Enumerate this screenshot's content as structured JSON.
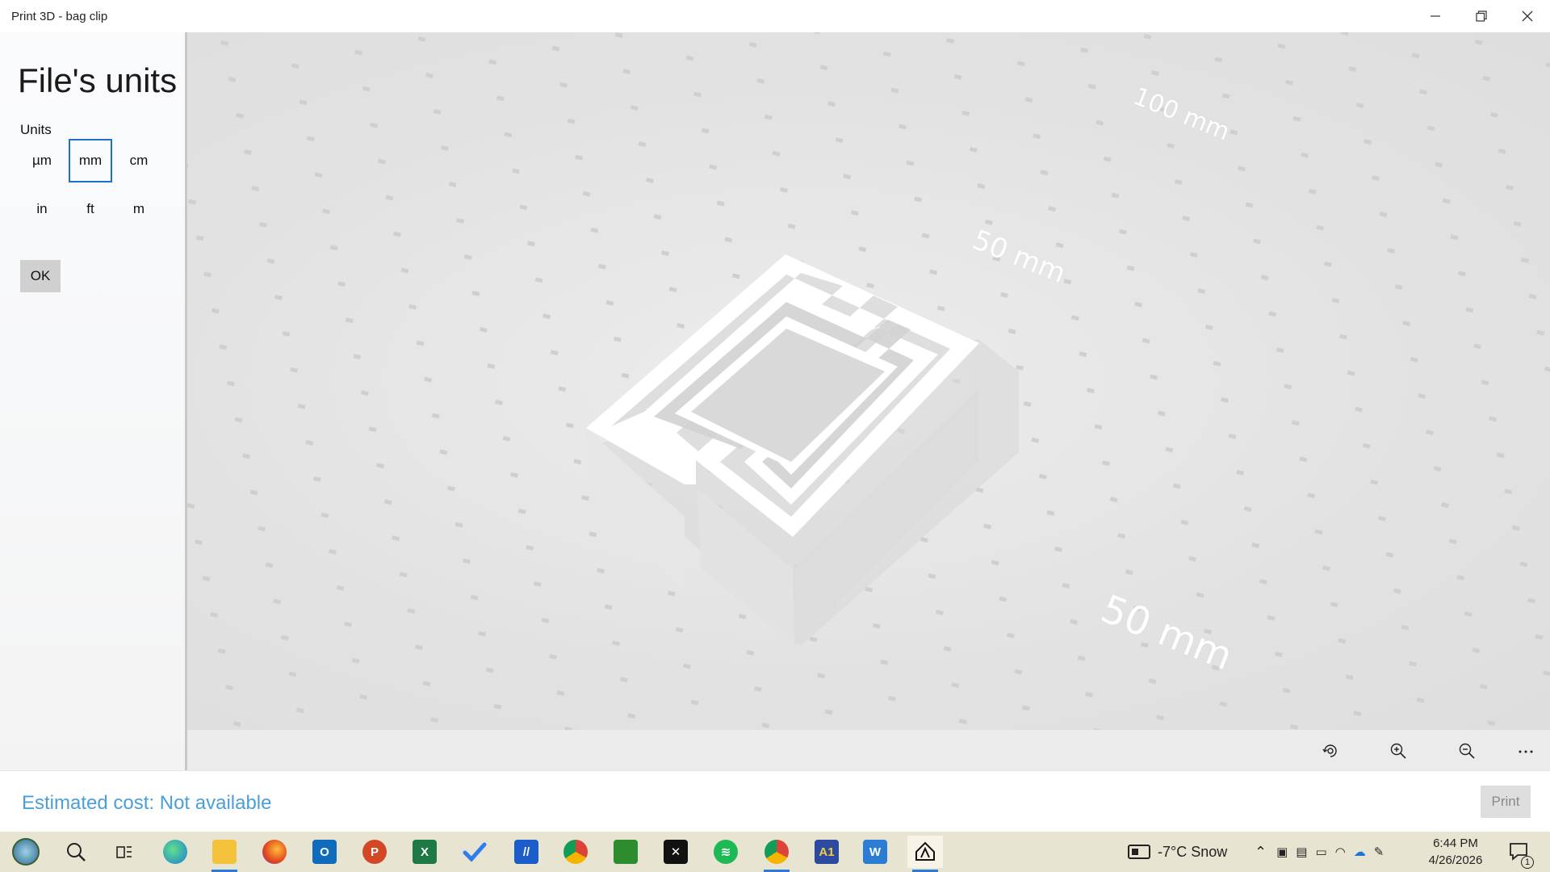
{
  "window": {
    "title": "Print 3D - bag clip",
    "controls": [
      "minimize-icon",
      "restore-icon",
      "close-icon"
    ]
  },
  "panel": {
    "title": "File's units",
    "units_label": "Units",
    "units": [
      {
        "label": "µm",
        "selected": false
      },
      {
        "label": "mm",
        "selected": true
      },
      {
        "label": "cm",
        "selected": false
      },
      {
        "label": "in",
        "selected": false
      },
      {
        "label": "ft",
        "selected": false
      },
      {
        "label": "m",
        "selected": false
      }
    ],
    "ok_label": "OK"
  },
  "viewport": {
    "measurements": [
      "100 mm",
      "50 mm",
      "50 mm"
    ],
    "model": "bag clip",
    "tools": [
      "view-reset-icon",
      "zoom-in-icon",
      "zoom-out-icon",
      "more-options-icon"
    ]
  },
  "footer": {
    "cost": "Estimated cost: Not available",
    "print_label": "Print"
  },
  "taskbar": {
    "apps": [
      "start-icon",
      "search-icon",
      "task-view-icon",
      "edge-icon",
      "file-explorer-icon",
      "firefox-icon",
      "outlook-icon",
      "powerpoint-icon",
      "excel-icon",
      "todo-icon",
      "app-icon",
      "chrome-icon",
      "minecraft-icon",
      "capcut-icon",
      "spotify-icon",
      "chrome-profile-icon",
      "a1-app-icon",
      "word-icon",
      "print3d-icon"
    ],
    "weather": "-7°C  Snow",
    "time": "6:44 PM",
    "date": "4/26/2026",
    "notification_count": "1"
  },
  "colors": {
    "accent": "#1a73c9",
    "cost_text": "#4a9fd8",
    "taskbar": "#e8e4d2"
  }
}
